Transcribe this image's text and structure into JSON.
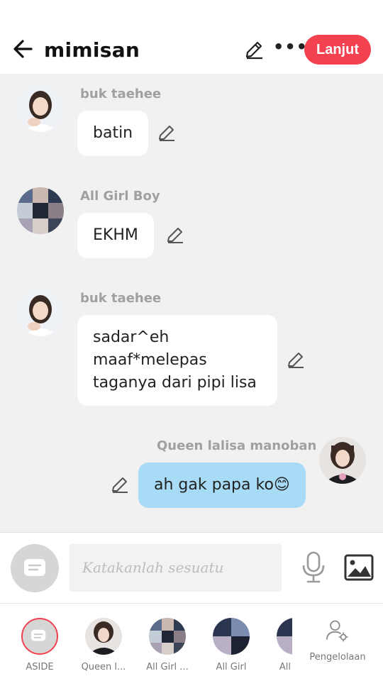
{
  "header": {
    "title": "mimisan",
    "next_label": "Lanjut"
  },
  "messages": [
    {
      "author": "buk taehee",
      "text": "batin"
    },
    {
      "author": "All Girl Boy",
      "text": "EKHM"
    },
    {
      "author": "buk taehee",
      "lines": [
        "sadar^eh",
        "maaf*melepas",
        "taganya dari pipi lisa"
      ]
    },
    {
      "author": "Queen lalisa manoban",
      "text": "ah gak papa ko😊"
    }
  ],
  "composer": {
    "placeholder": "Katakanlah sesuatu"
  },
  "tabs": [
    {
      "label": "ASIDE"
    },
    {
      "label": "Queen l..."
    },
    {
      "label": "All Girl ..."
    },
    {
      "label": "All Girl"
    },
    {
      "label": "All"
    },
    {
      "label": "Pengelolaan"
    }
  ],
  "colors": {
    "accent_red": "#f44150",
    "my_bubble": "#a8dcf6",
    "background": "#f1f1f1",
    "author_gray": "#a0a0a0"
  }
}
